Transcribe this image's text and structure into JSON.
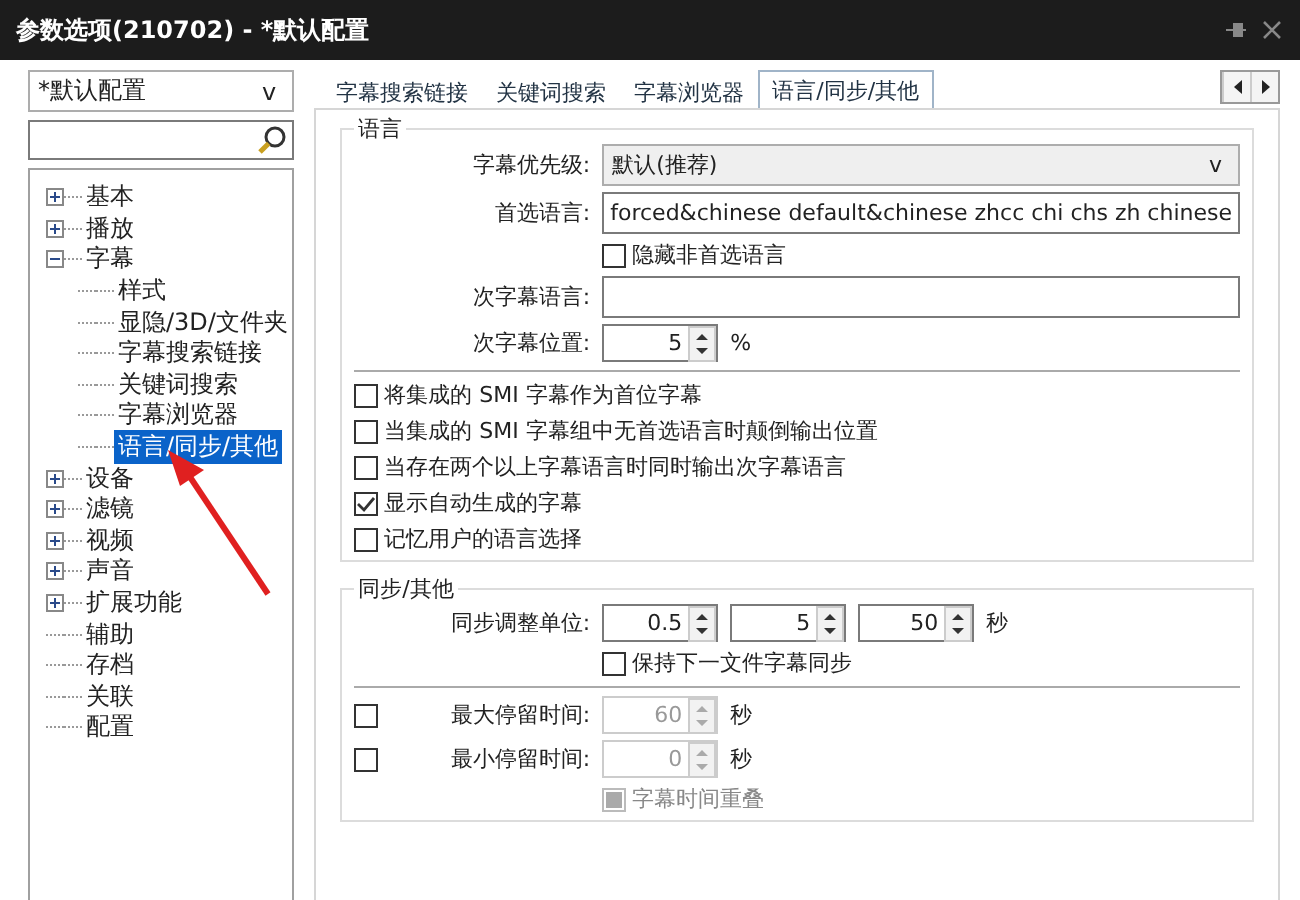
{
  "window": {
    "title": "参数选项(210702) - *默认配置"
  },
  "profile_select": {
    "value": "*默认配置",
    "caret": "v"
  },
  "tree": [
    {
      "label": "基本",
      "expanded": false,
      "selected": false
    },
    {
      "label": "播放",
      "expanded": false,
      "selected": false
    },
    {
      "label": "字幕",
      "expanded": true,
      "selected": false,
      "children": [
        {
          "label": "样式",
          "selected": false
        },
        {
          "label": "显隐/3D/文件夹",
          "selected": false
        },
        {
          "label": "字幕搜索链接",
          "selected": false
        },
        {
          "label": "关键词搜索",
          "selected": false
        },
        {
          "label": "字幕浏览器",
          "selected": false
        },
        {
          "label": "语言/同步/其他",
          "selected": true
        }
      ]
    },
    {
      "label": "设备",
      "expanded": false,
      "selected": false
    },
    {
      "label": "滤镜",
      "expanded": false,
      "selected": false
    },
    {
      "label": "视频",
      "expanded": false,
      "selected": false
    },
    {
      "label": "声音",
      "expanded": false,
      "selected": false
    },
    {
      "label": "扩展功能",
      "expanded": false,
      "selected": false
    },
    {
      "label": "辅助",
      "selected": false
    },
    {
      "label": "存档",
      "selected": false
    },
    {
      "label": "关联",
      "selected": false
    },
    {
      "label": "配置",
      "selected": false
    }
  ],
  "tabs": [
    {
      "label": "字幕搜索链接",
      "selected": false
    },
    {
      "label": "关键词搜索",
      "selected": false
    },
    {
      "label": "字幕浏览器",
      "selected": false
    },
    {
      "label": "语言/同步/其他",
      "selected": true
    }
  ],
  "language_group": {
    "title": "语言",
    "rows": [
      {
        "kind": "select",
        "label": "字幕优先级:",
        "value": "默认(推荐)",
        "caret": "v"
      },
      {
        "kind": "text",
        "label": "首选语言:",
        "value": "forced&chinese default&chinese zhcc chi chs zh chinese"
      },
      {
        "kind": "checkbox",
        "label": "隐藏非首选语言",
        "checked": false
      },
      {
        "kind": "text",
        "label": "次字幕语言:"
      },
      {
        "kind": "spin",
        "label": "次字幕位置:",
        "value": "5",
        "unit": "%"
      }
    ],
    "options": [
      {
        "label": "将集成的 SMI 字幕作为首位字幕",
        "checked": false
      },
      {
        "label": "当集成的 SMI 字幕组中无首选语言时颠倒输出位置",
        "checked": false
      },
      {
        "label": "当存在两个以上字幕语言时同时输出次字幕语言",
        "checked": false
      },
      {
        "label": "显示自动生成的字幕",
        "checked": true
      },
      {
        "label": "记忆用户的语言选择",
        "checked": false
      }
    ]
  },
  "sync_group": {
    "title": "同步/其他",
    "sync_label": "同步调整单位:",
    "spins": [
      "0.5",
      "5",
      "50"
    ],
    "unit": "秒",
    "keep_sync": {
      "label": "保持下一文件字幕同步",
      "checked": false
    },
    "dwell": [
      {
        "enabled": false,
        "label": "最大停留时间:",
        "value": "60",
        "unit": "秒"
      },
      {
        "enabled": false,
        "label": "最小停留时间:",
        "value": "0",
        "unit": "秒"
      }
    ],
    "overlap": {
      "label": "字幕时间重叠",
      "checked": true,
      "disabled": true
    }
  }
}
